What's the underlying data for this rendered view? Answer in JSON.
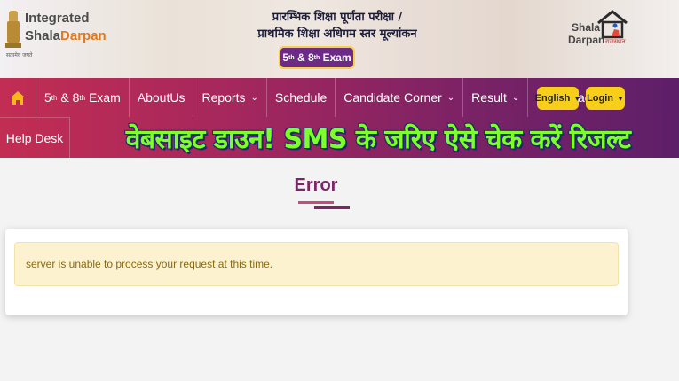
{
  "header": {
    "brand_line1": "Integrated",
    "brand_line2_a": "Shala",
    "brand_line2_b": "Darpan",
    "emblem_caption": "सत्यमेव जयते",
    "title_line1": "प्रारम्भिक शिक्षा पूर्णता परीक्षा /",
    "title_line2": "प्राथमिक शिक्षा अधिगम स्तर मूल्यांकन",
    "exam_badge": {
      "n1": "5",
      "sup1": "th",
      "mid": " & ",
      "n2": "8",
      "sup2": "th",
      "tail": " Exam"
    },
    "right_logo_line1": "Shala",
    "right_logo_line2": "Darpan",
    "right_logo_sub": "राजस्थान"
  },
  "nav": {
    "items": [
      {
        "n1": "5",
        "sup1": "th",
        "mid": " & ",
        "n2": "8",
        "sup2": "th",
        "tail": " Exam"
      },
      {
        "label": "AboutUs"
      },
      {
        "label": "Reports",
        "caret": "⌄"
      },
      {
        "label": "Schedule"
      },
      {
        "label": "Candidate Corner",
        "caret": "⌄"
      },
      {
        "label": "Result",
        "caret": "⌄"
      },
      {
        "label": "Download"
      }
    ],
    "help_desk": "Help Desk",
    "language": "English",
    "login": "Login",
    "caret": "▼"
  },
  "headline": "वेबसाइट डाउन! SMS के जरिए ऐसे चेक करें रिजल्ट",
  "error": {
    "title": "Error",
    "message": "server is unable to process your request at this time."
  },
  "colors": {
    "nav_start": "#c22d53",
    "nav_end": "#5d1f68",
    "accent_yellow": "#f7cf1a",
    "headline_green": "#7cff2a",
    "error_title": "#7b2667",
    "alert_bg": "#fdf2cf"
  }
}
